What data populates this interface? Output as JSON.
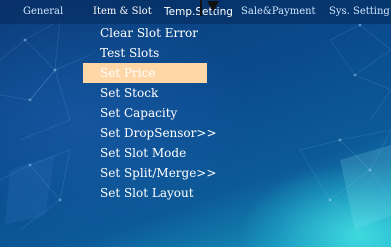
{
  "colors": {
    "background": "#0a4a8c",
    "selection": "#ffd7a6",
    "text": "#ffffff",
    "tab_text": "#cfe6ff"
  },
  "top_tabs": [
    {
      "label": "General",
      "active": false
    },
    {
      "label": "Item & Slot",
      "active": true
    },
    {
      "label": "Temp.Setting",
      "active": false
    },
    {
      "label": "Sale&Payment",
      "active": false
    },
    {
      "label": "Sys. Setting",
      "active": false
    }
  ],
  "indicator_icon": "arrow-down-icon",
  "menu": {
    "selected_index": 2,
    "items": [
      {
        "label": "Clear Slot Error"
      },
      {
        "label": "Test Slots"
      },
      {
        "label": "Set Price"
      },
      {
        "label": "Set Stock"
      },
      {
        "label": "Set Capacity"
      },
      {
        "label": "Set DropSensor>>"
      },
      {
        "label": "Set Slot Mode"
      },
      {
        "label": "Set Split/Merge>>"
      },
      {
        "label": "Set Slot Layout"
      }
    ]
  }
}
